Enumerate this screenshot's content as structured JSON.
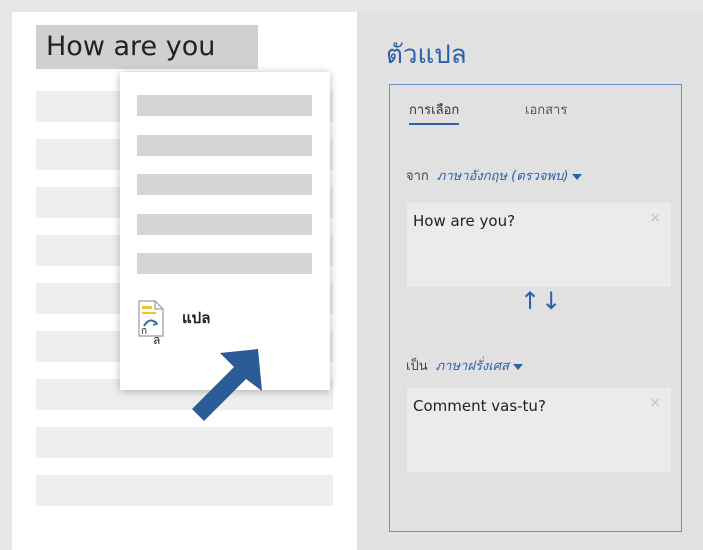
{
  "document": {
    "title_text": "How are you"
  },
  "context_menu": {
    "translate_label": "แปล",
    "translate_icon": "translate-icon"
  },
  "translator": {
    "title": "ตัวแปล",
    "tabs": [
      {
        "label": "การเลือก",
        "active": true
      },
      {
        "label": "เอกสาร",
        "active": false
      }
    ],
    "from": {
      "prefix": "จาก",
      "language": "ภาษาอังกฤษ (ตรวจพบ)",
      "text": "How are you?",
      "clear_glyph": "×"
    },
    "swap_glyph": "↑↓",
    "to": {
      "prefix": "เป็น",
      "language": "ภาษาฝรั่งเศส",
      "text": "Comment vas-tu?",
      "clear_glyph": "×"
    }
  },
  "colors": {
    "accent": "#2c5fa8",
    "arrow": "#2b5c96",
    "icon_yellow": "#f3c332"
  }
}
